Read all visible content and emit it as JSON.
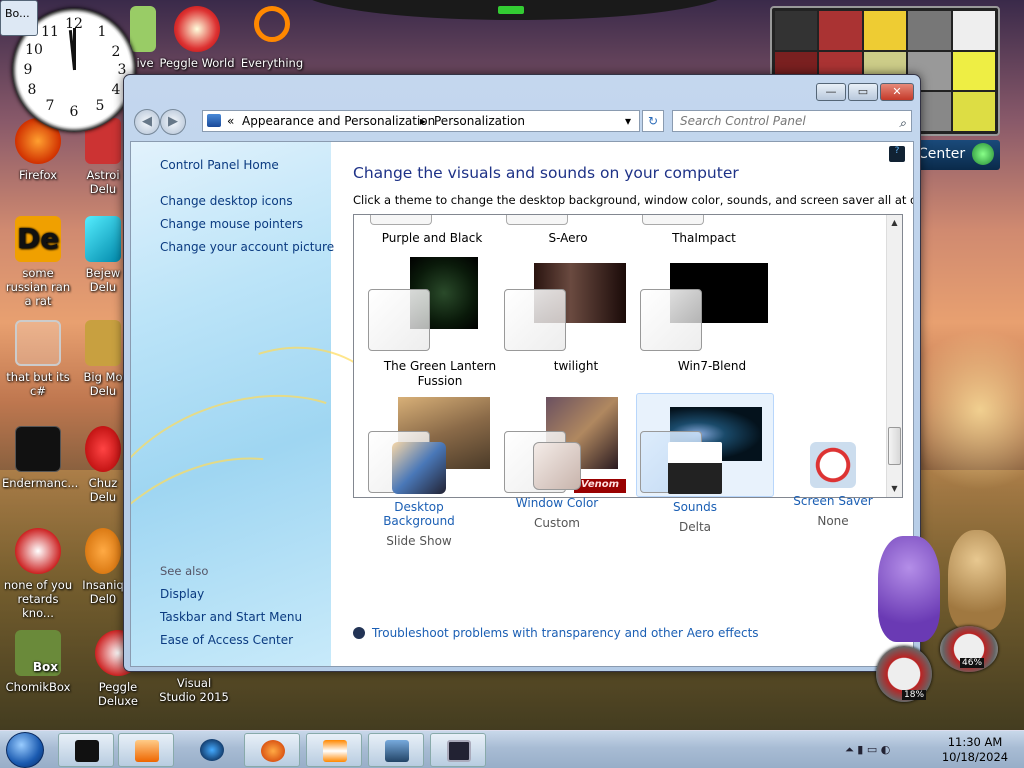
{
  "desktop": {
    "task_tab": "Bo...",
    "icons": [
      {
        "label": "Firefox"
      },
      {
        "label": "Astroi Delu"
      },
      {
        "label": "some russian ran a rat"
      },
      {
        "label": "Bejew Delu"
      },
      {
        "label": "that but its c#"
      },
      {
        "label": "Big Mo Delu"
      },
      {
        "label": "Endermanc..."
      },
      {
        "label": "Chuz Delu"
      },
      {
        "label": "none of you retards kno..."
      },
      {
        "label": "Insaniq Del0"
      },
      {
        "label": "ChomikBox"
      },
      {
        "label": "Peggle Deluxe"
      },
      {
        "label": "Visual Studio 2015"
      },
      {
        "label": "ive"
      },
      {
        "label": "Peggle World"
      },
      {
        "label": "Everything"
      }
    ],
    "clock_numbers": [
      "12",
      "1",
      "2",
      "3",
      "4",
      "5",
      "6",
      "7",
      "8",
      "9",
      "10",
      "11"
    ],
    "media_center_label": "Center",
    "gauge_values": [
      "46%",
      "18%"
    ]
  },
  "window": {
    "controls": {
      "minimize": "—",
      "maximize": "▭",
      "close": "✕"
    },
    "back": "◀",
    "forward": "▶",
    "address": {
      "sep": "«",
      "crumb1": "Appearance and Personalization",
      "arrow": "▸",
      "crumb2": "Personalization",
      "dropdown": "▾"
    },
    "refresh": "↻",
    "search_placeholder": "Search Control Panel",
    "search_icon": "⌕",
    "left_nav": {
      "home": "Control Panel Home",
      "links": [
        "Change desktop icons",
        "Change mouse pointers",
        "Change your account picture"
      ],
      "see_also_label": "See also",
      "see_also": [
        "Display",
        "Taskbar and Start Menu",
        "Ease of Access Center"
      ]
    },
    "help": "?",
    "heading": "Change the visuals and sounds on your computer",
    "subheading": "Click a theme to change the desktop background, window color, sounds, and screen saver all at once.",
    "themes_top_row": [
      "Purple and Black",
      "S-Aero",
      "ThaImpact"
    ],
    "themes_middle_row": [
      {
        "name": "The Green Lantern Fussion",
        "colors": [
          "#0a1a0a",
          "#2a4a2a"
        ]
      },
      {
        "name": "twilight",
        "colors": [
          "#1a0a08",
          "#5a3a30"
        ]
      },
      {
        "name": "Win7-Blend",
        "colors": [
          "#000000",
          "#111111"
        ]
      }
    ],
    "themes_bottom_row": [
      {
        "name": "",
        "colors": [
          "#d8b078",
          "#6a5a48"
        ]
      },
      {
        "name": "",
        "colors": [
          "#4a3a40",
          "#b08860"
        ],
        "logo": "Venom"
      },
      {
        "name": "",
        "colors": [
          "#04121c",
          "#1a4a6a"
        ]
      }
    ],
    "scroll_up": "▲",
    "scroll_down": "▼",
    "options": [
      {
        "label": "Desktop Background",
        "value": "Slide Show",
        "icon": "desktop-background-icon"
      },
      {
        "label": "Window Color",
        "value": "Custom",
        "icon": "window-color-icon"
      },
      {
        "label": "Sounds",
        "value": "Delta",
        "icon": "sounds-icon"
      },
      {
        "label": "Screen Saver",
        "value": "None",
        "icon": "screen-saver-icon"
      }
    ],
    "troubleshoot": "Troubleshoot problems with transparency and other Aero effects"
  },
  "taskbar": {
    "tray_icons": "⏶ ▮ ▭ ◐",
    "time": "11:30 AM",
    "date": "10/18/2024"
  }
}
